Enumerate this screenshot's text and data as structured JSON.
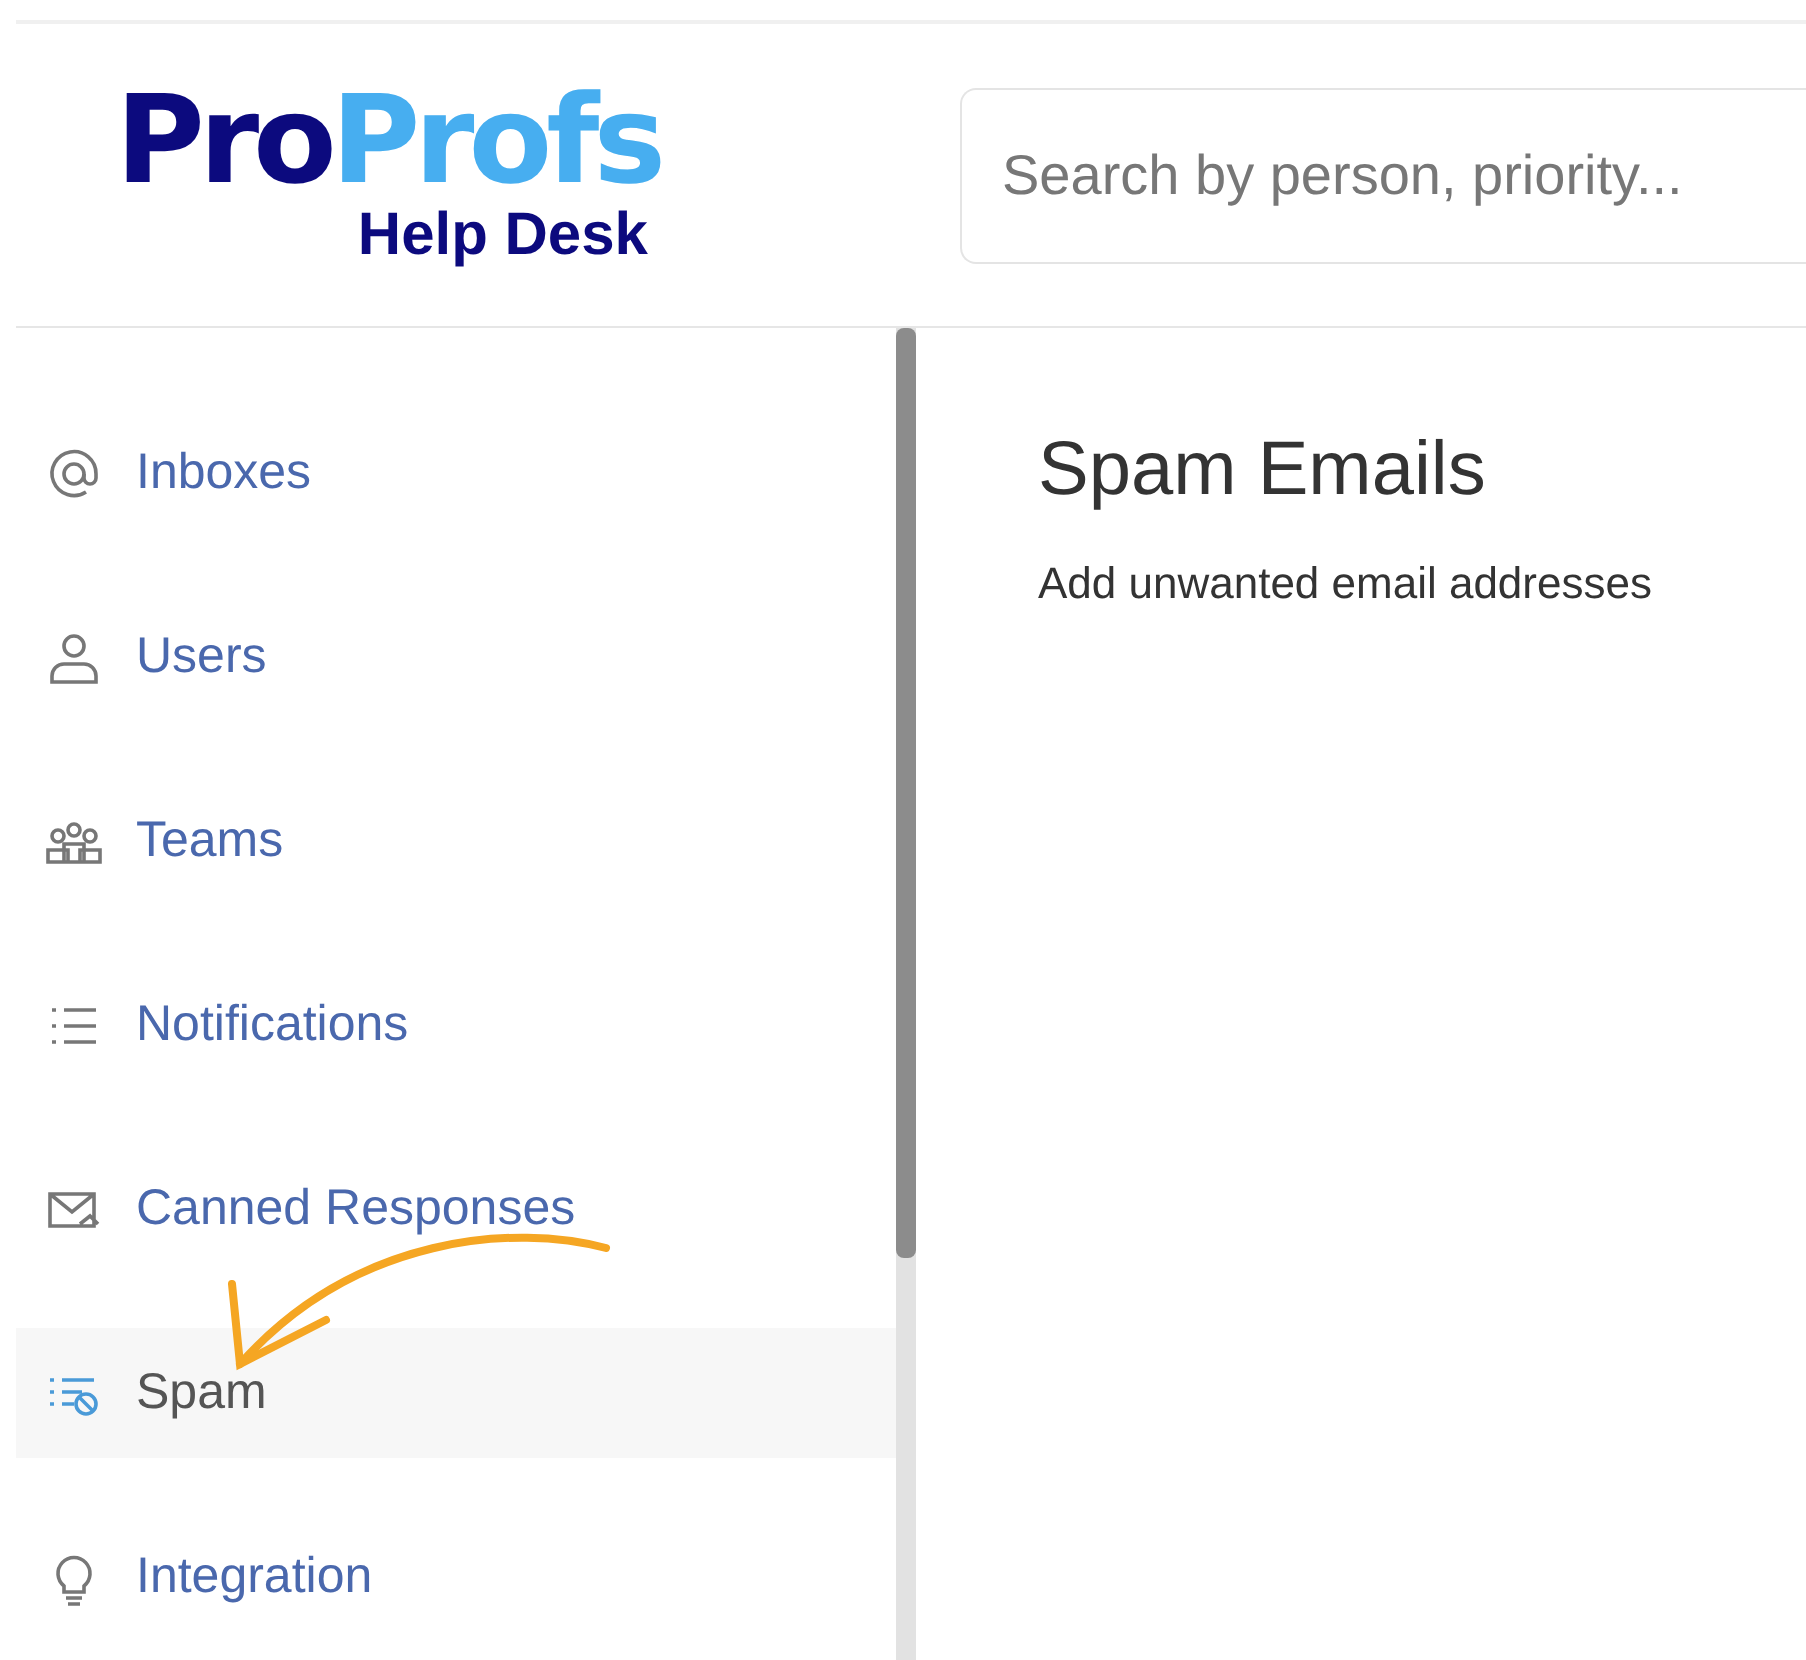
{
  "logo": {
    "part_1": "Pro",
    "part_2": "Profs",
    "subtitle": "Help Desk"
  },
  "search": {
    "placeholder": "Search by person, priority..."
  },
  "sidebar": {
    "items": [
      {
        "label": "Inboxes",
        "kind": "at",
        "selected": false
      },
      {
        "label": "Users",
        "kind": "user",
        "selected": false
      },
      {
        "label": "Teams",
        "kind": "team",
        "selected": false
      },
      {
        "label": "Notifications",
        "kind": "list",
        "selected": false
      },
      {
        "label": "Canned Responses",
        "kind": "mail",
        "selected": false
      },
      {
        "label": "Spam",
        "kind": "spam",
        "selected": true
      },
      {
        "label": "Integration",
        "kind": "bulb",
        "selected": false
      }
    ]
  },
  "main": {
    "title": "Spam Emails",
    "description": "Add unwanted email addresses"
  }
}
